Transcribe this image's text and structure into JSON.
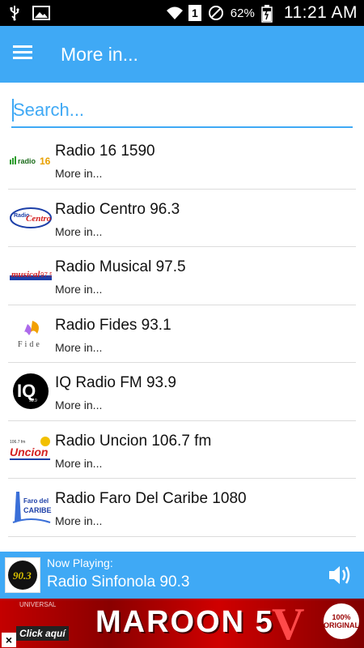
{
  "status_bar": {
    "time": "11:21 AM",
    "battery": "62%",
    "sim_badge": "1",
    "icons": [
      "usb-icon",
      "image-icon",
      "wifi-icon",
      "sim-icon",
      "do-not-disturb-icon",
      "battery-icon"
    ]
  },
  "app_bar": {
    "title": "More in...",
    "menu_icon": "hamburger-menu-icon"
  },
  "search": {
    "placeholder": "Search...",
    "value": ""
  },
  "stations": [
    {
      "name": "Radio 16 1590",
      "sub": "More in...",
      "logo_text": "radio 16"
    },
    {
      "name": "Radio Centro 96.3",
      "sub": "More in...",
      "logo_text": "Radio Centro"
    },
    {
      "name": "Radio Musical 97.5",
      "sub": "More in...",
      "logo_text": "musical 97.5"
    },
    {
      "name": "Radio Fides 93.1",
      "sub": "More in...",
      "logo_text": "Fide"
    },
    {
      "name": "IQ Radio FM 93.9",
      "sub": "More in...",
      "logo_text": "IQ"
    },
    {
      "name": "Radio Uncion 106.7 fm",
      "sub": "More in...",
      "logo_text": "Uncion"
    },
    {
      "name": "Radio Faro Del Caribe 1080",
      "sub": "More in...",
      "logo_text": "Faro del CARIBE"
    }
  ],
  "now_playing": {
    "label": "Now Playing:",
    "title": "Radio Sinfonola 90.3",
    "logo_text": "90.3",
    "volume_icon": "volume-icon"
  },
  "ad": {
    "click_label": "Click aquí",
    "brand": "MAROON 5",
    "small_label": "UNIVERSAL",
    "letter": "V",
    "badge": "100% ORIGINAL"
  },
  "colors": {
    "accent": "#3fa9f5",
    "status_bar": "#000000",
    "divider": "#dcdcdc"
  }
}
